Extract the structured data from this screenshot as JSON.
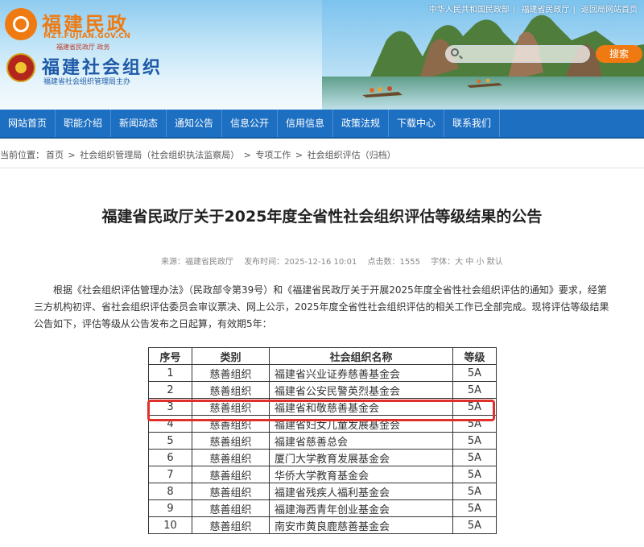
{
  "header": {
    "top_links": [
      "中华人民共和国民政部",
      "福建省民政厅",
      "返回局网站首页"
    ],
    "site1_title": "福建民政",
    "site1_url": "MZT.FUJIAN.GOV.CN",
    "site1_sub": "福建省民政厅 政务",
    "site2_title": "福建社会组织",
    "site2_sub": "福建省社会组织管理局主办",
    "search_placeholder": "",
    "search_button": "搜索"
  },
  "nav": [
    "网站首页",
    "职能介绍",
    "新闻动态",
    "通知公告",
    "信息公开",
    "信用信息",
    "政策法规",
    "下载中心",
    "联系我们"
  ],
  "breadcrumb": [
    "当前位置：",
    "首页",
    " > ",
    "社会组织管理局（社会组织执法监察局）",
    " > ",
    "专项工作",
    " > ",
    "社会组织评估（归档）"
  ],
  "article": {
    "title": "福建省民政厅关于2025年度全省性社会组织评估等级结果的公告",
    "source_label": "来源：",
    "source": "福建省民政厅",
    "date_label": "发布时间：",
    "date": "2025-12-16 10:01",
    "hits_label": "点击数：",
    "hits": "1555",
    "font_label": "字体：",
    "font_sizes": [
      "大",
      "中",
      "小",
      "默认"
    ],
    "body": "根据《社会组织评估管理办法》（民政部令第39号）和《福建省民政厅关于开展2025年度全省性社会组织评估的通知》要求，经第三方机构初评、省社会组织评估委员会审议票决、网上公示，2025年度全省性社会组织评估的相关工作已全部完成。现将评估等级结果公告如下，评估等级从公告发布之日起算，有效期5年："
  },
  "table": {
    "headers": [
      "序号",
      "类别",
      "社会组织名称",
      "等级"
    ],
    "rows": [
      [
        "1",
        "慈善组织",
        "福建省兴业证券慈善基金会",
        "5A"
      ],
      [
        "2",
        "慈善组织",
        "福建省公安民警英烈基金会",
        "5A"
      ],
      [
        "3",
        "慈善组织",
        "福建省和敬慈善基金会",
        "5A"
      ],
      [
        "4",
        "慈善组织",
        "福建省妇女儿童发展基金会",
        "5A"
      ],
      [
        "5",
        "慈善组织",
        "福建省慈善总会",
        "5A"
      ],
      [
        "6",
        "慈善组织",
        "厦门大学教育发展基金会",
        "5A"
      ],
      [
        "7",
        "慈善组织",
        "华侨大学教育基金会",
        "5A"
      ],
      [
        "8",
        "慈善组织",
        "福建省残疾人福利基金会",
        "5A"
      ],
      [
        "9",
        "慈善组织",
        "福建海西青年创业基金会",
        "5A"
      ],
      [
        "10",
        "慈善组织",
        "南安市黄良鹿慈善基金会",
        "5A"
      ]
    ],
    "highlighted_row": 3
  },
  "colors": {
    "nav_bg": "#1d6fc2",
    "accent_orange": "#f07a12",
    "highlight_red": "#e0302a"
  }
}
